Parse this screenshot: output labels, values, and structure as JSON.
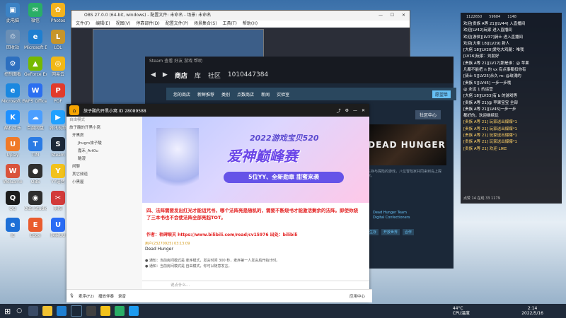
{
  "desktop": {
    "icons": [
      {
        "label": "此电脑",
        "color": "#3b82c4",
        "glyph": "▣"
      },
      {
        "label": "微信",
        "color": "#2aae67",
        "glyph": "✉"
      },
      {
        "label": "Photos",
        "color": "#f3b31e",
        "glyph": "✿"
      },
      {
        "label": "回收站",
        "color": "#6b8fb5",
        "glyph": "♲"
      },
      {
        "label": "Microsoft Edge",
        "color": "#1f7fd1",
        "glyph": "e"
      },
      {
        "label": "LOL",
        "color": "#c6952a",
        "glyph": "L"
      },
      {
        "label": "控制面板",
        "color": "#2d6fbf",
        "glyph": "⚙"
      },
      {
        "label": "GeForce Experience",
        "color": "#76b900",
        "glyph": "▲"
      },
      {
        "label": "网易云",
        "color": "#f1b816",
        "glyph": "◎"
      },
      {
        "label": "Microsoft Edge",
        "color": "#1b88e0",
        "glyph": "e"
      },
      {
        "label": "WPS Office",
        "color": "#2b6ff0",
        "glyph": "W"
      },
      {
        "label": "PDF",
        "color": "#e23b2c",
        "glyph": "P"
      },
      {
        "label": "酷狗音乐",
        "color": "#1e90ff",
        "glyph": "K"
      },
      {
        "label": "百度网盘",
        "color": "#4a9eff",
        "glyph": "☁"
      },
      {
        "label": "腾讯视频",
        "color": "#20a1ff",
        "glyph": "▶"
      },
      {
        "label": "Uplay",
        "color": "#f07a28",
        "glyph": "U"
      },
      {
        "label": "TIM",
        "color": "#2a7be4",
        "glyph": "T"
      },
      {
        "label": "Steam",
        "color": "#1b2838",
        "glyph": "S"
      },
      {
        "label": "WeGame",
        "color": "#d9533c",
        "glyph": "W"
      },
      {
        "label": "OBS",
        "color": "#303030",
        "glyph": "●"
      },
      {
        "label": "YY语音",
        "color": "#f2c21c",
        "glyph": "Y"
      },
      {
        "label": "QQ",
        "color": "#1c1c1c",
        "glyph": "Q"
      },
      {
        "label": "OBS Studio",
        "color": "#2e2e2e",
        "glyph": "◉"
      },
      {
        "label": "剪映",
        "color": "#d23b3b",
        "glyph": "✂"
      },
      {
        "label": "IE",
        "color": "#1d6fd6",
        "glyph": "e"
      },
      {
        "label": "Edge",
        "color": "#e95c2e",
        "glyph": "E"
      },
      {
        "label": "网易UU",
        "color": "#2a6cf5",
        "glyph": "U"
      }
    ]
  },
  "obs": {
    "title": "OBS 27.0.0 (64-bit, windows) - 配置文件: 未命名 - 场景: 未命名",
    "menu": [
      "文件(F)",
      "编辑(E)",
      "视图(V)",
      "停靠部件(D)",
      "配置文件(P)",
      "场景集合(S)",
      "工具(T)",
      "帮助(H)"
    ]
  },
  "steam": {
    "topbar": "Steam  查看  好友  游戏  帮助",
    "nav": [
      "商店",
      "库",
      "社区",
      "1010447384"
    ],
    "sub": [
      "您的商店",
      "新鲜推荐",
      "类别",
      "点数商店",
      "新闻",
      "实验室"
    ],
    "community": "社区中心",
    "game_banner": "DEAD HUNGER",
    "info": "生存与探险的游戏，八位冒险家共同来到岛上探索。",
    "developer": [
      "Dead Hunger Team",
      "Digital Confectioners"
    ],
    "tags": [
      "生存",
      "开放世界",
      "合作"
    ],
    "wishlist": "愿望单"
  },
  "huya": {
    "title": "旅子酸的开黑小窝  ID 28089588",
    "side_title": "自由模式",
    "side_rows": [
      "旅子酸的开黑小窝",
      "开黑房",
      "Jhugrs旅子酸",
      "嘉禾_Art0u",
      "酷漫",
      "闲聊",
      "其它频道",
      "小黑屋"
    ],
    "ad": {
      "t1": "2022游戏宝贝520",
      "t2": "爱神巅峰赛",
      "t3": "5位YY、全新勋章 甜蜜来袭"
    },
    "red1": "四、法阵需要发出红光才能诅咒书，哪个法阵亮是随机的，需要不断烧书才能激活剩余的法阵。即使你烧了三本书也不会使法阵全部亮起TOT。",
    "red2": "作者：枯碑眼灭  https://www.bilibili.com/read/cv15976  出处：bilibili",
    "msg1": "用户(23270925)  03:13:09",
    "msg2": "Dead Hunger",
    "msg3": "● 通知：当前房间模式是 麦序模式，发言时间 300 秒，麦序第一人发言后开始计时。",
    "msg4": "● 通知：当前房间模式是 自由模式，你可以随意发言。",
    "input_ph": "说点什么...",
    "bottom": [
      "麦序(F2)",
      "播放伴奏",
      "录音",
      "应用中心"
    ]
  },
  "chat": {
    "header": [
      "1122650",
      "59684",
      "1148"
    ],
    "lines": [
      "欢迎[贵族 A等 21][LV44] 入直播间",
      "欢迎[LV42]玩家 进入直播间",
      "欢迎[游侠][LV37]骑士 进入直播间",
      "欢迎[大佬 18][LV29] 新人",
      "[大佬 18][LV20]爱吃大鸡腿：唯我",
      "[LV16]玩家：刘朋好",
      "[贵族 A等 21][LV17]那是谁：@ 苹果",
      "凡都不能把 n 的 vx 有点事都扣你有",
      "[骑士 5][LV25]永久 m: @玫瑰的",
      "[贵族 5][LV45] 一步一步哦",
      "@ 永远 1 的运营",
      "[大佬 18][LV33]有 b 的游戏等",
      "[贵族 A等 21]@ 苹果宝宝 全部",
      "[贵族 A等 21][LV45]一步一步",
      "都好的，欢迎继续玩",
      "[贵族 A等 21] 玩家送出爆爆*1",
      "[贵族 A等 21] 玩家送出爆爆*1",
      "[贵族 A等 21] 玩家送出爆爆*1",
      "[贵族 A等 21] 玩家送出爆爆*1",
      "[贵族 A等 21] 欢迎 LIKE"
    ],
    "footer": "点赞 14  在线 33  1179"
  },
  "taskbar": {
    "temp": "44°C",
    "temp2": "CPU温度",
    "time": "2:14",
    "date": "2022/5/16"
  }
}
